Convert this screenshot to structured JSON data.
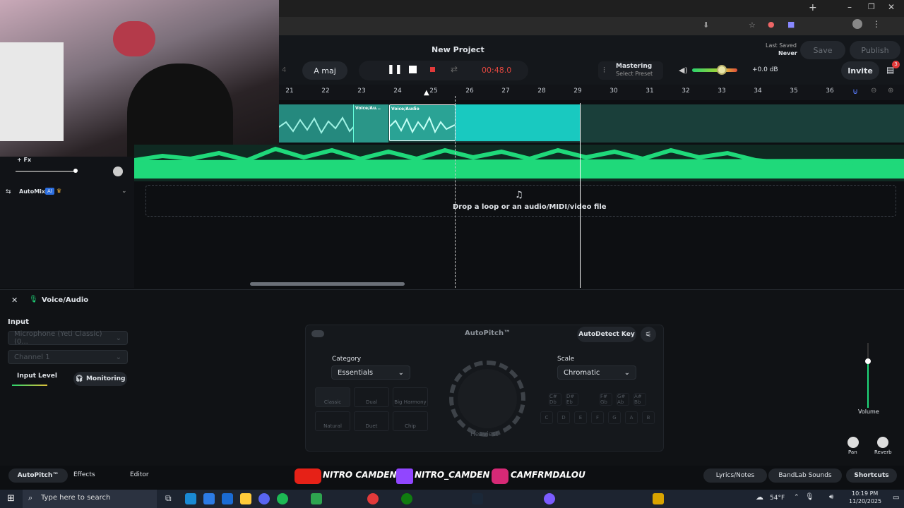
{
  "browser": {
    "tab_icons": [
      "tab-icon",
      "tab-icon",
      "tab-icon"
    ]
  },
  "header": {
    "project_title": "New Project",
    "track_name": "A maj",
    "time": "00:48.0",
    "mastering_label": "Mastering",
    "mastering_preset": "Select Preset",
    "db_value": "+0.0 dB",
    "last_saved_label": "Last Saved",
    "last_saved_value": "Never",
    "save_label": "Save",
    "publish_label": "Publish",
    "invite_label": "Invite",
    "notification_count": "3"
  },
  "ruler": {
    "ticks": [
      "21",
      "22",
      "23",
      "24",
      "25",
      "26",
      "27",
      "28",
      "29",
      "30",
      "31",
      "32",
      "33",
      "34",
      "35",
      "36"
    ]
  },
  "tracks": {
    "clip1_label": "Voice/Au...",
    "clip2_label": "Voice/Audio",
    "fx_label": "+ Fx",
    "automix_label": "AutoMix",
    "ai_badge": "AI",
    "drop_text": "Drop a loop or an audio/MIDI/video file"
  },
  "bottom_panel": {
    "title": "Voice/Audio",
    "input_heading": "Input",
    "input_device": "Microphone (Yeti Classic) (0...",
    "channel": "Channel 1",
    "input_level_label": "Input Level",
    "monitoring_label": "Monitoring",
    "autopitch_title": "AutoPitch™",
    "autodetect_label": "AutoDetect Key",
    "category_label": "Category",
    "category_value": "Essentials",
    "scale_label": "Scale",
    "scale_value": "Chromatic",
    "knob_label": "Heaviest",
    "effects_grid": [
      "Classic",
      "Dual",
      "Big Harmony",
      "Natural",
      "Duet",
      "Chip"
    ],
    "key_row1": [
      "C#\nDb",
      "D#\nEb",
      "F#\nGb",
      "G#\nAb",
      "A#\nBb"
    ],
    "key_row2": [
      "C",
      "D",
      "E",
      "F",
      "G",
      "A",
      "B"
    ],
    "volume_label": "Volume",
    "pan_label": "Pan",
    "reverb_label": "Reverb"
  },
  "footer": {
    "tab_autopitch": "AutoPitch™",
    "tab_effects": "Effects",
    "tab_editor": "Editor",
    "lyrics_label": "Lyrics/Notes",
    "sounds_label": "BandLab Sounds",
    "shortcuts_label": "Shortcuts",
    "overlay_youtube": "NITRO CAMDEN",
    "overlay_twitch": "NITRO_CAMDEN",
    "overlay_instagram": "CAMFRMDALOU"
  },
  "taskbar": {
    "search_placeholder": "Type here to search",
    "weather": "54°F",
    "time": "10:19 PM",
    "date": "11/20/2025"
  },
  "colors": {
    "accent": "#1fd97a",
    "teal": "#19c9c0",
    "record": "#e23a3a",
    "time_text": "#e3473f"
  }
}
